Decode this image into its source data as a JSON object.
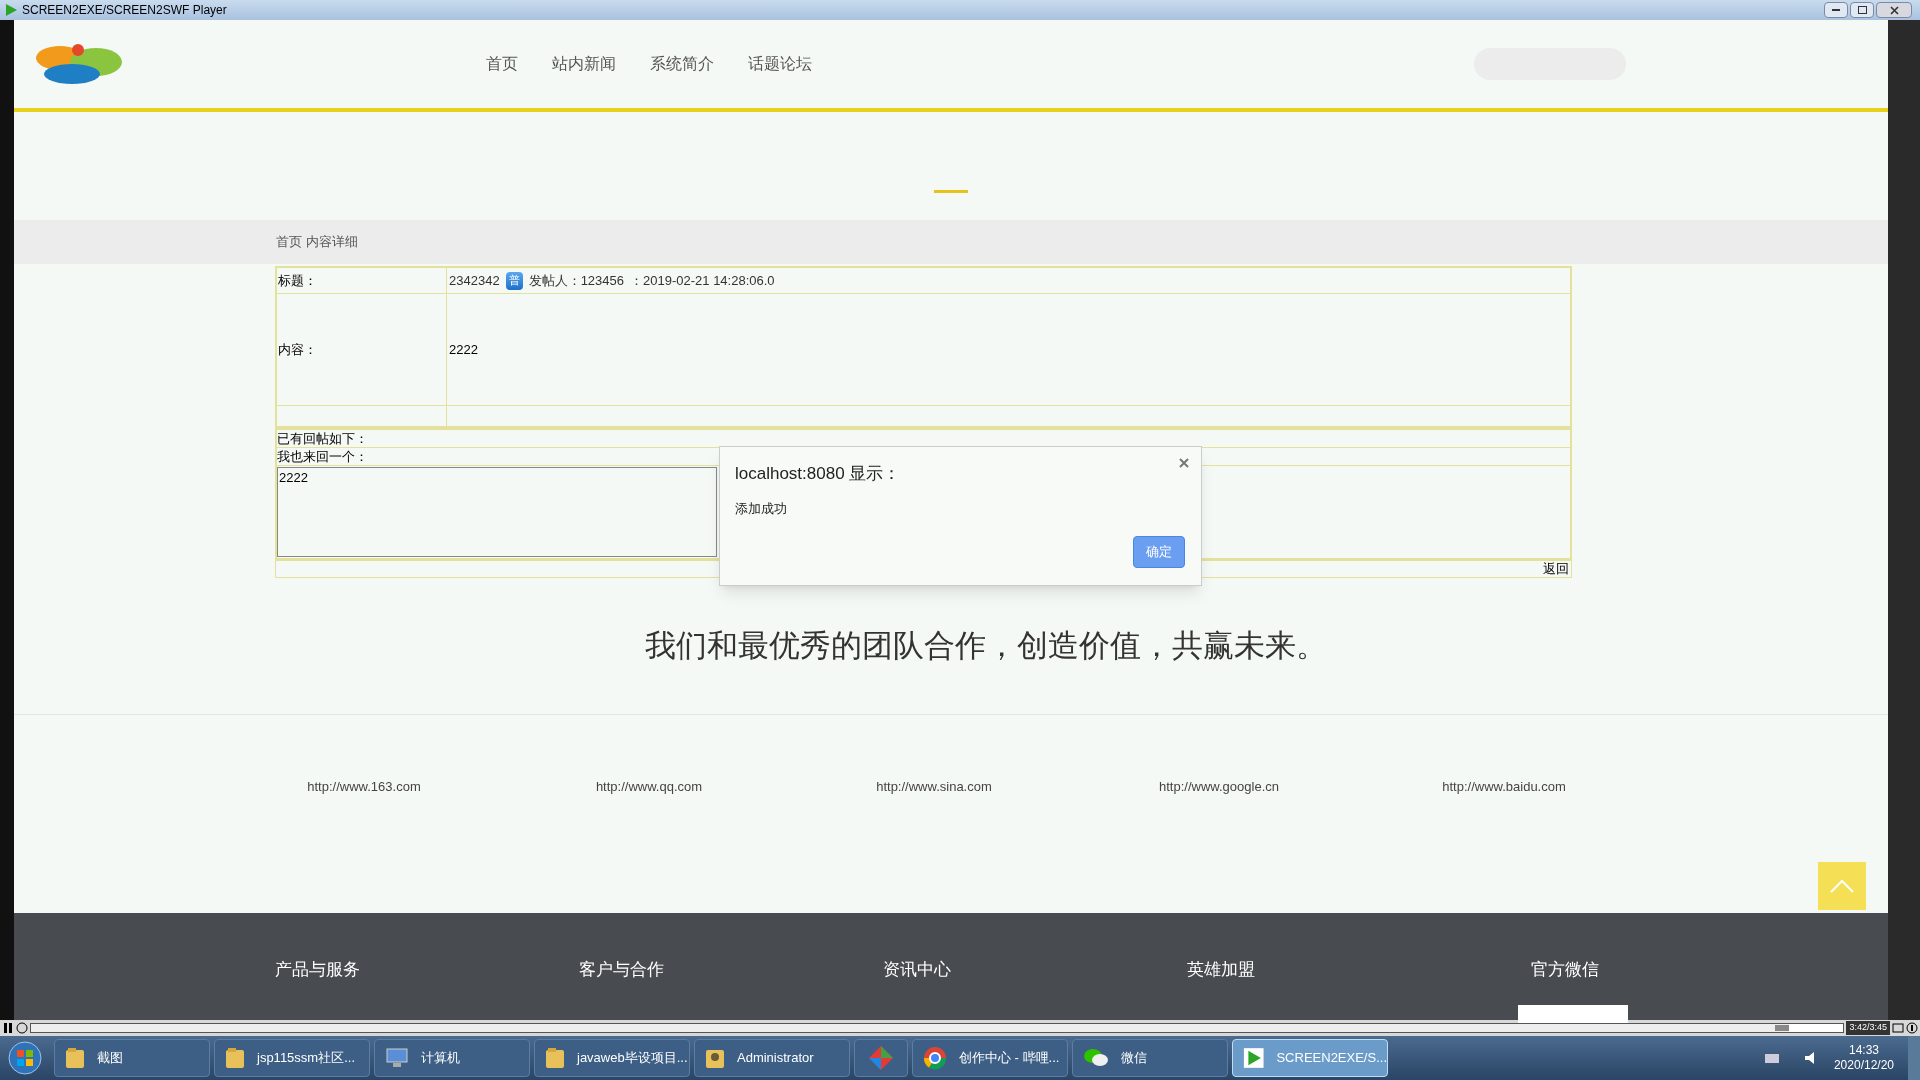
{
  "window": {
    "title": "SCREEN2EXE/SCREEN2SWF Player"
  },
  "nav": {
    "items": [
      "首页",
      "站内新闻",
      "系统简介",
      "话题论坛"
    ]
  },
  "breadcrumb": "首页 内容详细",
  "post": {
    "title_label": "标题：",
    "title": "2342342",
    "badge": "普",
    "author": "发帖人：123456",
    "time": "：2019-02-21 14:28:06.0",
    "content_label": "内容：",
    "content": "2222"
  },
  "replies": {
    "heading": "已有回帖如下：",
    "reply_label": "我也来回一个：",
    "reply_value": "2222",
    "back_link": "返回"
  },
  "dialog": {
    "title": "localhost:8080 显示：",
    "message": "添加成功",
    "ok": "确定"
  },
  "slogan": "我们和最优秀的团队合作，创造价值，共赢未来。",
  "links": [
    "http://www.163.com",
    "http://www.qq.com",
    "http://www.sina.com",
    "http://www.google.cn",
    "http://www.baidu.com"
  ],
  "footer": {
    "columns": [
      "产品与服务",
      "客户与合作",
      "资讯中心",
      "英雄加盟",
      "官方微信"
    ]
  },
  "player": {
    "time": "3:42/3:45",
    "level": 0.97
  },
  "taskbar": {
    "items": [
      {
        "kind": "folder",
        "label": "截图",
        "selected": false
      },
      {
        "kind": "folder",
        "label": "jsp115ssm社区...",
        "selected": false
      },
      {
        "kind": "computer",
        "label": "计算机",
        "selected": false
      },
      {
        "kind": "folder",
        "label": "javaweb毕设项目...",
        "selected": false
      },
      {
        "kind": "user",
        "label": "Administrator",
        "selected": false
      },
      {
        "kind": "app",
        "selected": false
      },
      {
        "kind": "browser",
        "label": "创作中心 - 哔哩...",
        "selected": false
      },
      {
        "kind": "chat",
        "label": "微信",
        "selected": false
      },
      {
        "kind": "player",
        "label": "SCREEN2EXE/S...",
        "selected": true
      }
    ],
    "time": "14:33",
    "date": "2020/12/20"
  }
}
